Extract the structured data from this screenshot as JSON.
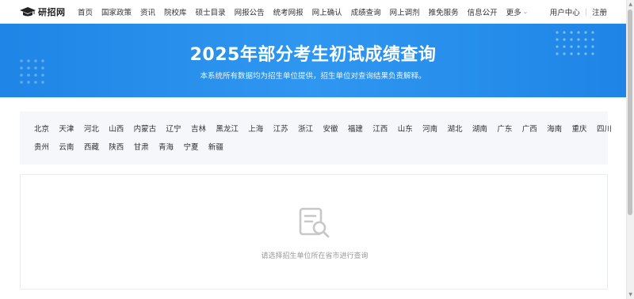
{
  "header": {
    "logo_text": "研招网",
    "nav": [
      "首页",
      "国家政策",
      "资讯",
      "院校库",
      "硕士目录",
      "网报公告",
      "统考网报",
      "网上确认",
      "成绩查询",
      "网上调剂",
      "推免服务",
      "信息公开",
      "更多"
    ],
    "user_center": "用户中心",
    "register": "注册",
    "separator": "|"
  },
  "banner": {
    "title": "2025年部分考生初试成绩查询",
    "subtitle": "本系统所有数据均为招生单位提供，招生单位对查询结果负责解释。"
  },
  "provinces": {
    "row1": [
      "北京",
      "天津",
      "河北",
      "山西",
      "内蒙古",
      "辽宁",
      "吉林",
      "黑龙江",
      "上海",
      "江苏",
      "浙江",
      "安徽",
      "福建",
      "江西",
      "山东",
      "河南",
      "湖北",
      "湖南",
      "广东",
      "广西",
      "海南",
      "重庆",
      "四川"
    ],
    "row2": [
      "贵州",
      "云南",
      "西藏",
      "陕西",
      "甘肃",
      "青海",
      "宁夏",
      "新疆"
    ]
  },
  "result": {
    "empty_text": "请选择招生单位所在省市进行查询",
    "icon": "document-search-icon"
  },
  "colors": {
    "banner_blue": "#2b8ff0",
    "panel_bg": "#f5f7fa"
  }
}
